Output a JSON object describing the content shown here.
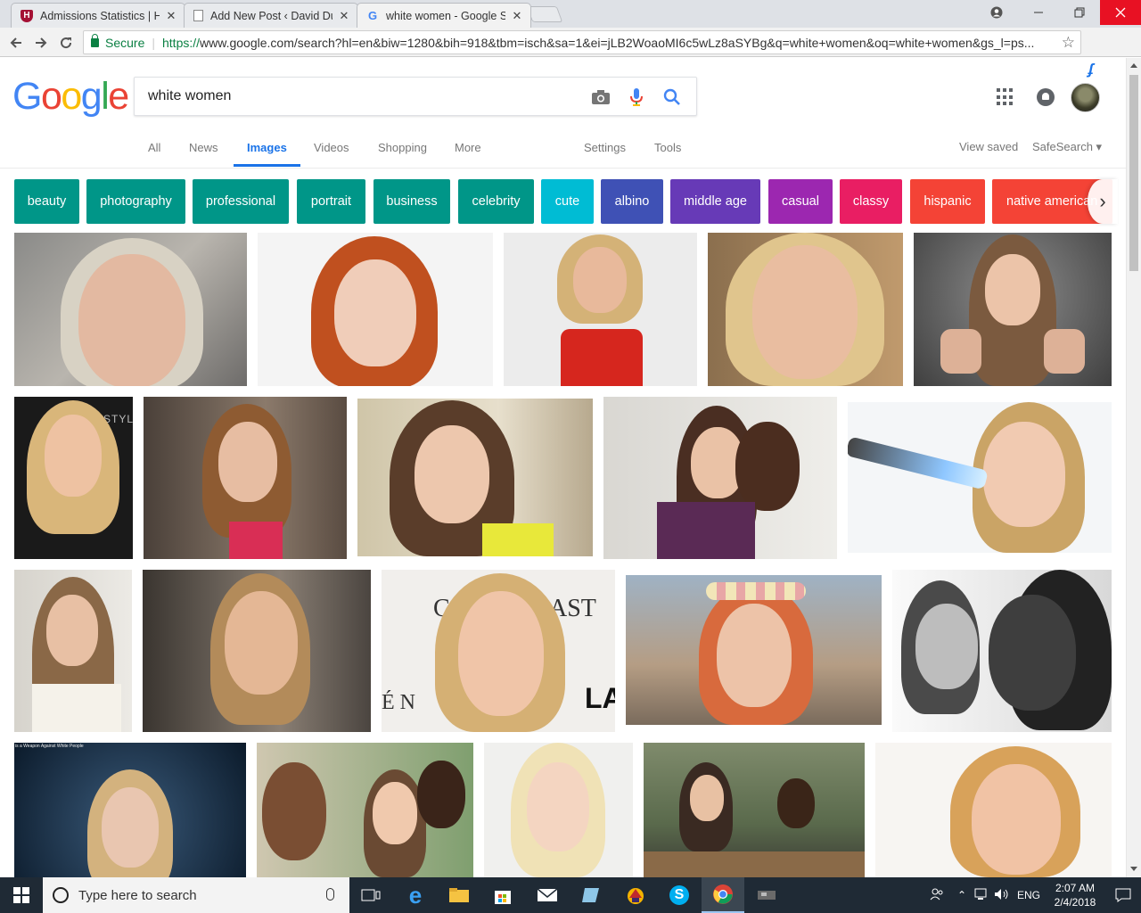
{
  "browser": {
    "tabs": [
      {
        "title": "Admissions Statistics | Ha",
        "favicon": "harvard-shield-icon"
      },
      {
        "title": "Add New Post ‹ David Du",
        "favicon": "page-icon"
      },
      {
        "title": "white women - Google S",
        "favicon": "google-g-icon"
      }
    ],
    "secure_label": "Secure",
    "url_protocol": "https://",
    "url_rest": "www.google.com/search?hl=en&biw=1280&bih=918&tbm=isch&sa=1&ei=jLB2WoaoMI6c5wLz8aSYBg&q=white+women&oq=white+women&gs_l=ps..."
  },
  "google": {
    "logo": [
      "G",
      "o",
      "o",
      "g",
      "l",
      "e"
    ],
    "logo_colors": [
      "#4285f4",
      "#ea4335",
      "#fbbc05",
      "#4285f4",
      "#34a853",
      "#ea4335"
    ],
    "query": "white women"
  },
  "nav": {
    "all": "All",
    "news": "News",
    "images": "Images",
    "videos": "Videos",
    "shopping": "Shopping",
    "more": "More",
    "settings": "Settings",
    "tools": "Tools",
    "view_saved": "View saved",
    "safesearch": "SafeSearch"
  },
  "chips": [
    {
      "label": "beauty",
      "color": "#009688"
    },
    {
      "label": "photography",
      "color": "#009688"
    },
    {
      "label": "professional",
      "color": "#009688"
    },
    {
      "label": "portrait",
      "color": "#009688"
    },
    {
      "label": "business",
      "color": "#009688"
    },
    {
      "label": "celebrity",
      "color": "#009688"
    },
    {
      "label": "cute",
      "color": "#00bcd4"
    },
    {
      "label": "albino",
      "color": "#3f51b5"
    },
    {
      "label": "middle age",
      "color": "#673ab7"
    },
    {
      "label": "casual",
      "color": "#9c27b0"
    },
    {
      "label": "classy",
      "color": "#e91e63"
    },
    {
      "label": "hispanic",
      "color": "#f44336"
    },
    {
      "label": "native american",
      "color": "#f44336"
    }
  ],
  "images": {
    "caption_15": "is a Weapon Against White People",
    "text_12a": "C",
    "text_12b": "AST",
    "text_12c": "É N",
    "text_12d": "LA",
    "text_6": "STYL"
  },
  "taskbar": {
    "search_placeholder": "Type here to search",
    "language": "ENG",
    "time": "2:07 AM",
    "date": "2/4/2018"
  }
}
